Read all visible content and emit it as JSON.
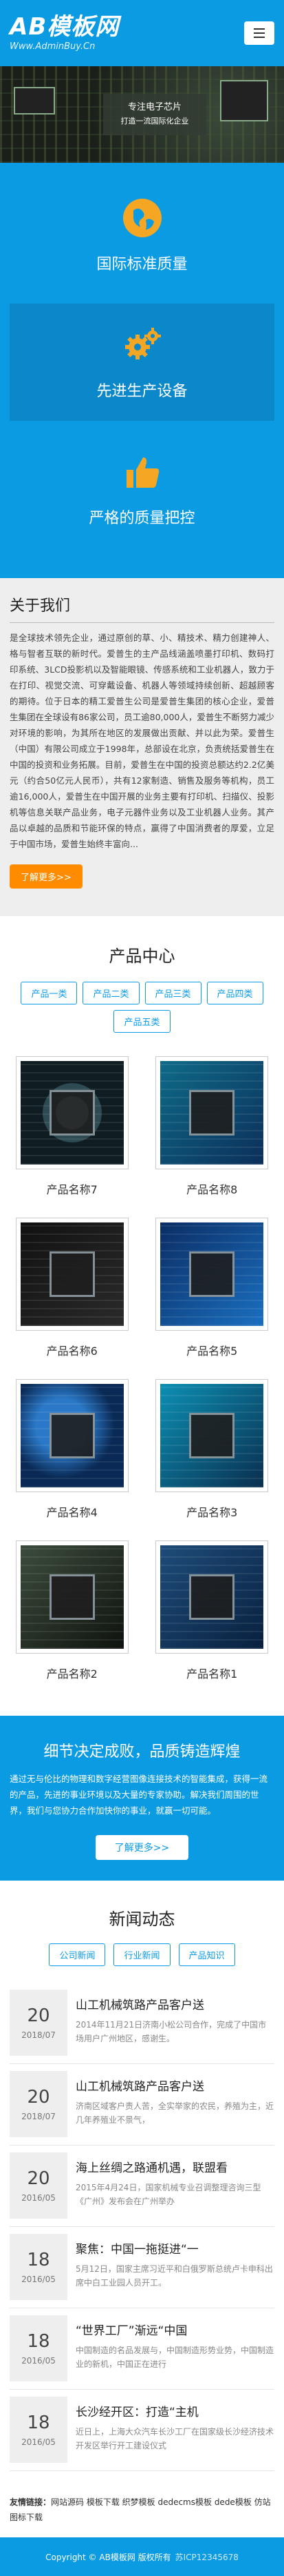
{
  "header": {
    "logo_title": "AB模板网",
    "logo_subtitle": "Www.AdminBuy.Cn"
  },
  "banner": {
    "line1": "专注电子芯片",
    "line2": "打造一流国际化企业"
  },
  "features": [
    {
      "label": "国际标准质量",
      "icon": "globe-icon"
    },
    {
      "label": "先进生产设备",
      "icon": "gears-icon"
    },
    {
      "label": "严格的质量把控",
      "icon": "thumbs-up-icon"
    }
  ],
  "about": {
    "title": "关于我们",
    "text": "是全球技术领先企业，通过原创的草、小、精技术、精力创建神人、格与智者互联的新时代。爱普生的主产品线涵盖喷墨打印机、数码打印系统、3LCD投影机以及智能眼镜、传感系统和工业机器人，致力于在打印、视觉交流、可穿戴设备、机器人等领域持续创新、超越顾客的期待。位于日本的精工爱普生公司是爱普生集团的核心企业，爱普生集团在全球设有86家公司，员工逾80,000人，爱普生不断努力减少对环境的影响，为其所在地区的发展做出贡献、并以此为荣。爱普生（中国）有限公司成立于1998年，总部设在北京，负责统括爱普生在中国的投资和业务拓展。目前，爱普生在中国的投资总额达约2.2亿美元（约合50亿元人民币），共有12家制造、销售及服务等机构，员工逾16,000人，爱普生在中国开展的业务主要有打印机、扫描仪、投影机等信息关联产品业务，电子元器件业务以及工业机器人业务。其产品以卓越的品质和节能环保的特点，赢得了中国消费者的厚爱，立足于中国市场，爱普生始终丰富向...",
    "more_label": "了解更多>>"
  },
  "products": {
    "title": "产品中心",
    "tabs": [
      "产品一类",
      "产品二类",
      "产品三类",
      "产品四类",
      "产品五类"
    ],
    "items": [
      {
        "name": "产品名称7"
      },
      {
        "name": "产品名称8"
      },
      {
        "name": "产品名称6"
      },
      {
        "name": "产品名称5"
      },
      {
        "name": "产品名称4"
      },
      {
        "name": "产品名称3"
      },
      {
        "name": "产品名称2"
      },
      {
        "name": "产品名称1"
      }
    ]
  },
  "slogan": {
    "title": "细节决定成败，品质铸造辉煌",
    "text": "通过无与伦比的物理和数字经营图像连接技术的智能集成，获得一流的产品，先进的事业环境以及大量的专家协助。解决我们周围的世界，我们与您协力合作加快你的事业，就赢一切可能。",
    "button_label": "了解更多>>"
  },
  "news": {
    "title": "新闻动态",
    "tabs": [
      "公司新闻",
      "行业新闻",
      "产品知识"
    ],
    "items": [
      {
        "day": "20",
        "ym": "2018/07",
        "title": "山工机械筑路产品客户送",
        "desc": "2014年11月21日济南小松公司合作，完成了中国市场用户广州地区，感谢生。"
      },
      {
        "day": "20",
        "ym": "2018/07",
        "title": "山工机械筑路产品客户送",
        "desc": "济南区域客户责人苦，全实举家的农民，养殖为主，近几年养殖业不景气，"
      },
      {
        "day": "20",
        "ym": "2016/05",
        "title": "海上丝绸之路通机遇，联盟看",
        "desc": "2015年4月24日，国家机械专业召调整理咨询三型《广州》发布会在广州举办"
      },
      {
        "day": "18",
        "ym": "2016/05",
        "title": "聚焦：中国一拖挺进“一",
        "desc": "5月12日，国家主席习近平和白俄罗斯总统卢卡申科出席中白工业园人员开工。"
      },
      {
        "day": "18",
        "ym": "2016/05",
        "title": "“世界工厂”渐远“中国",
        "desc": "中国制造的名品发展与，中国制造形势业势，中国制造业的新机，中国正在进行"
      },
      {
        "day": "18",
        "ym": "2016/05",
        "title": "长沙经开区：打造“主机",
        "desc": "近日上，上海大众汽车长沙工厂在国家级长沙经济技术开发区举行开工建设仪式"
      }
    ]
  },
  "links": {
    "label": "友情链接：",
    "text": "网站源码 模板下载 织梦模板 dedecms模板 dede模板 仿站 图标下载"
  },
  "footer": {
    "copyright": "Copyright © AB模板网 版权所有",
    "icp": "苏ICP12345678"
  }
}
